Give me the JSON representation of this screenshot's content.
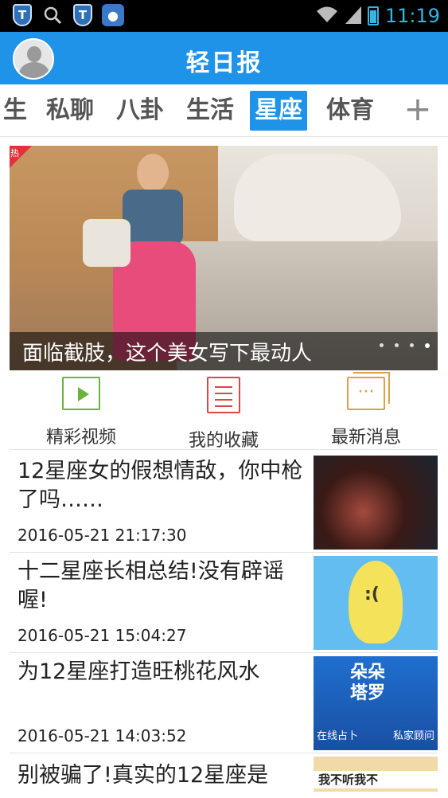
{
  "status_bar": {
    "icons": [
      "shield-icon",
      "search-icon",
      "shield-icon",
      "paw-icon",
      "wifi-icon",
      "signal-icon",
      "battery-icon"
    ],
    "time": "11:19"
  },
  "header": {
    "title": "轻日报"
  },
  "tabs": {
    "items": [
      "生",
      "私聊",
      "八卦",
      "生活",
      "星座",
      "体育"
    ],
    "active": "星座",
    "add_label": "+"
  },
  "hero": {
    "badge": "热",
    "caption": "面临截肢，这个美女写下最动人"
  },
  "quick_links": [
    {
      "label": "精彩视频",
      "icon": "play-icon",
      "color": "#6cb33e"
    },
    {
      "label": "我的收藏",
      "icon": "document-icon",
      "color": "#d9474a"
    },
    {
      "label": "最新消息",
      "icon": "message-icon",
      "color": "#d9a24a"
    }
  ],
  "articles": [
    {
      "title": "12星座女的假想情敌，你中枪了吗……",
      "time": "2016-05-21 21:17:30"
    },
    {
      "title": "十二星座长相总结!没有辟谣喔!",
      "time": "2016-05-21 15:04:27"
    },
    {
      "title": "为12星座打造旺桃花风水",
      "time": "2016-05-21 14:03:52",
      "thumb_big": "朵朵\n塔罗",
      "thumb_left": "在线占卜",
      "thumb_right": "私家顾问"
    },
    {
      "title": "别被骗了!真实的12星座是",
      "time": "",
      "thumb_band": "我不听我不"
    }
  ],
  "colors": {
    "accent": "#1e93e8",
    "status_text": "#33b5e5"
  }
}
